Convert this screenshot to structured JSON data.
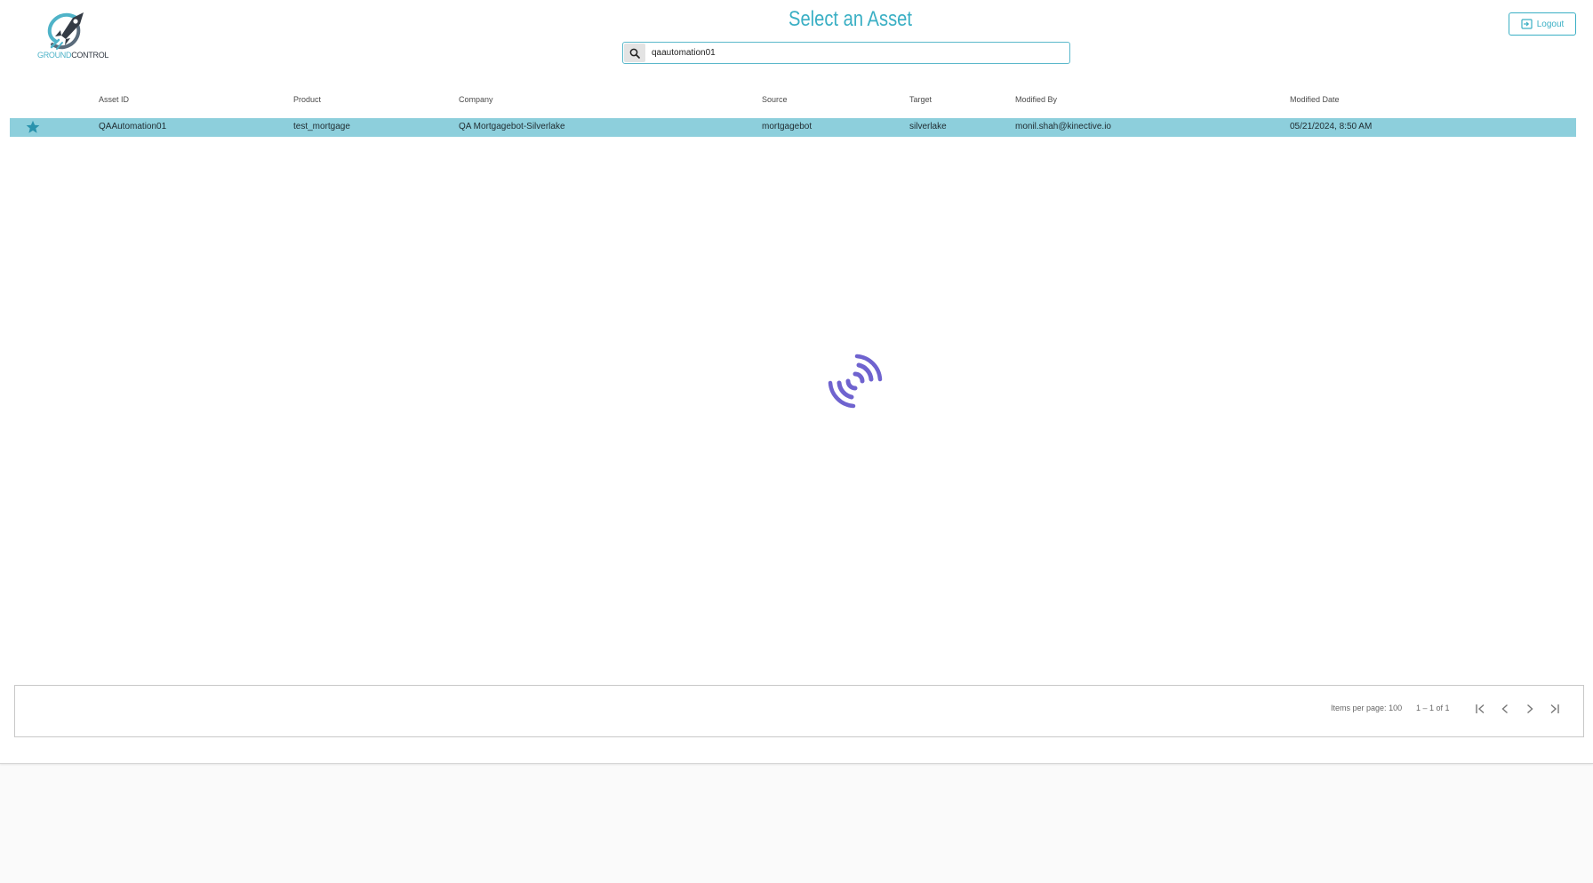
{
  "app": {
    "logo_text_part1": "GROUND",
    "logo_text_part2": "CONTROL",
    "title": "Select an Asset"
  },
  "search": {
    "value": "qaautomation01",
    "icon": "search-icon"
  },
  "logout": {
    "label": "Logout",
    "icon": "logout-icon"
  },
  "table": {
    "columns": [
      "Asset ID",
      "Product",
      "Company",
      "Source",
      "Target",
      "Modified By",
      "Modified Date"
    ],
    "rows": [
      {
        "favorite": true,
        "asset_id": "QAAutomation01",
        "product": "test_mortgage",
        "company": "QA Mortgagebot-Silverlake",
        "source": "mortgagebot",
        "target": "silverlake",
        "modified_by": "monil.shah@kinective.io",
        "modified_date": "05/21/2024, 8:50 AM"
      }
    ]
  },
  "paginator": {
    "items_per_page_label": "Items per page:",
    "items_per_page": "100",
    "range": "1 – 1 of 1"
  },
  "colors": {
    "accent": "#3aafc4",
    "row_highlight": "#8dcfdc",
    "spinner": "#6f63cf"
  }
}
